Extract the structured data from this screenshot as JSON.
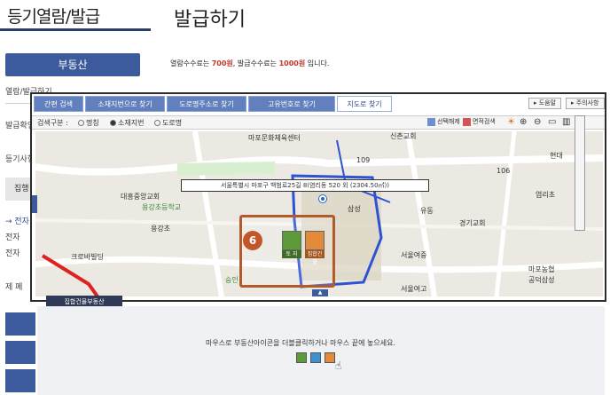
{
  "header": {
    "left_title": "등기열람/발급",
    "main_title": "발급하기"
  },
  "sidebar": {
    "primary_button": "부동산",
    "items": [
      {
        "label": "열람/발급하기"
      },
      {
        "label": "발급확인"
      },
      {
        "label": "등기사항"
      },
      {
        "label": "집행"
      },
      {
        "label": "→ 전자"
      },
      {
        "label": "전자"
      },
      {
        "label": "전자"
      },
      {
        "label": "제 폐"
      }
    ]
  },
  "fee_notice": {
    "prefix": "열람수수료는 ",
    "view_fee": "700원",
    "middle": ", 발급수수료는 ",
    "issue_fee": "1000원",
    "suffix": " 입니다."
  },
  "tabs": [
    {
      "label": "간편 검색",
      "active": false
    },
    {
      "label": "소재지번으로 찾기",
      "active": false
    },
    {
      "label": "도로명주소로 찾기",
      "active": false
    },
    {
      "label": "고유번호로 찾기",
      "active": false
    },
    {
      "label": "지도로 찾기",
      "active": true
    }
  ],
  "top_right_buttons": {
    "help": "▸ 도움말",
    "notice": "▸ 주의사항"
  },
  "options": {
    "label": "검색구분 :",
    "radio_1": "명칭",
    "radio_2": "소재지번",
    "radio_3": "도로명",
    "selected": "소재지번"
  },
  "map_tools": [
    {
      "label": "선택해제"
    },
    {
      "label": "면적검색"
    }
  ],
  "map": {
    "popup_address": "서울특별시 마포구 백범로25길 8(염리동 520 외 (2304.50㎡))",
    "badge_number": "6",
    "icon_labels": {
      "land": "토 지",
      "building": "집합건물"
    },
    "places": [
      {
        "name": "마포문화체육센터"
      },
      {
        "name": "신촌교회"
      },
      {
        "name": "대흥중앙교회"
      },
      {
        "name": "용강초등학교"
      },
      {
        "name": "용강초"
      },
      {
        "name": "서울여중"
      },
      {
        "name": "크로바빌딩"
      },
      {
        "name": "서울여고"
      },
      {
        "name": "경기교회"
      },
      {
        "name": "마포농협"
      },
      {
        "name": "공덕삼성"
      },
      {
        "name": "현대"
      },
      {
        "name": "유동"
      },
      {
        "name": "삼성"
      },
      {
        "name": "숭인"
      },
      {
        "name": "염리초"
      },
      {
        "name": "109"
      },
      {
        "name": "106"
      }
    ],
    "scale_marker": "▲"
  },
  "legend_tab": "집합건물부동산",
  "instruction": "마우스로 부동산아이콘을 더블클릭하거나 마우스 끝에 놓으세요."
}
